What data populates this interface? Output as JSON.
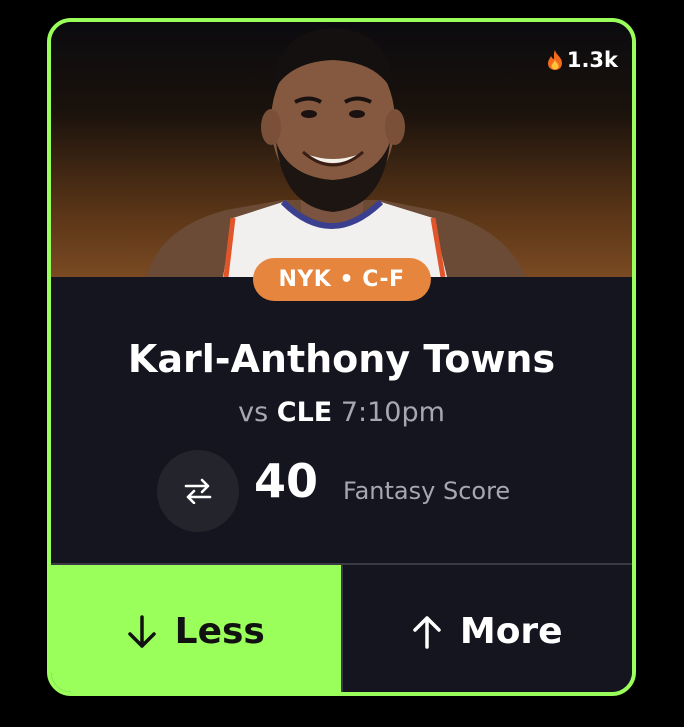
{
  "trending": {
    "icon": "flame-icon",
    "count": "1.3k"
  },
  "player": {
    "team_position": "NYK • C-F",
    "name": "Karl-Anthony Towns",
    "matchup_prefix": "vs",
    "opponent": "CLE",
    "game_time": "7:10pm"
  },
  "projection": {
    "swap_icon": "swap-icon",
    "value": "40",
    "stat_label": "Fantasy Score"
  },
  "actions": {
    "less_label": "Less",
    "more_label": "More"
  },
  "colors": {
    "accent": "#9aff5a",
    "badge": "#e6863e",
    "card_bg": "#15151f",
    "page_bg": "#000000"
  }
}
